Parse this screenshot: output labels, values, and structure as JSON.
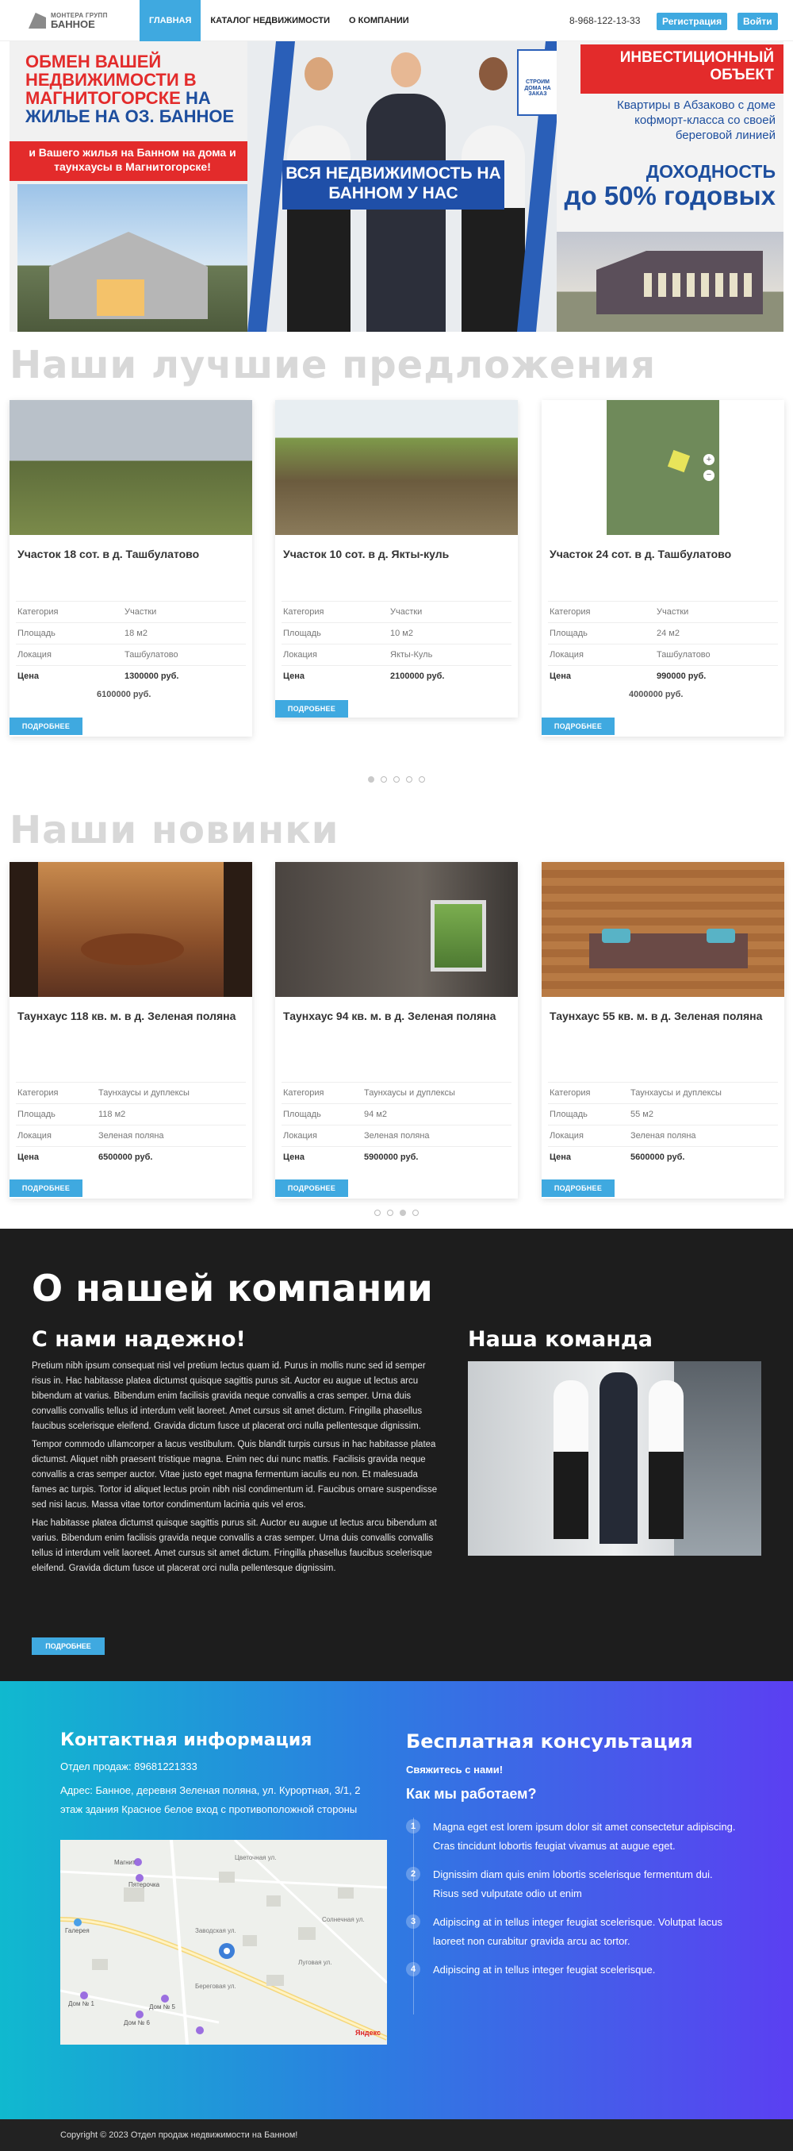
{
  "header": {
    "logo_line1": "МОНТЕРА ГРУПП",
    "logo_line2": "БАННОЕ",
    "nav": [
      "ГЛАВНАЯ",
      "КАТАЛОГ НЕДВИЖИМОСТИ",
      "О КОМПАНИИ"
    ],
    "active_nav": "ГЛАВНАЯ",
    "phone": "8-968-122-13-33",
    "register": "Регистрация",
    "login": "Войти"
  },
  "banner": {
    "left_title_red": "ОБМЕН ВАШЕЙ НЕДВИЖИМОСТИ В МАГНИТОГОРСКЕ",
    "left_title_blue": "НА ЖИЛЬЕ НА ОЗ. БАННОЕ",
    "left_red_box": "и Вашего жилья на Банном на дома и таунхаусы в Магнитогорске!",
    "center_box": "ВСЯ НЕДВИЖИМОСТЬ НА БАННОМ У НАС",
    "sign": "СТРОИМ ДОМА НА ЗАКАЗ",
    "right_red_box": "ИНВЕСТИЦИОННЫЙ ОБЪЕКТ",
    "right_sub": "Квартиры в Абзаково с доме кофморт-класса со своей береговой линией",
    "yield_line1": "ДОХОДНОСТЬ",
    "yield_line2": "до 50% годовых"
  },
  "best": {
    "title": "Наши лучшие предложения",
    "labels": {
      "category": "Категория",
      "area": "Площадь",
      "location": "Локация",
      "price": "Цена"
    },
    "more": "ПОДРОБНЕЕ",
    "cards": [
      {
        "title": "Участок 18 сот. в д. Ташбулатово",
        "category": "Участки",
        "area": "18 м2",
        "location": "Ташбулатово",
        "price": "1300000 руб.",
        "ghost_price": "6100000 руб."
      },
      {
        "title": "Участок 10 сот. в д. Якты-куль",
        "category": "Участки",
        "area": "10 м2",
        "location": "Якты-Куль",
        "price": "2100000 руб.",
        "ghost_price": ""
      },
      {
        "title": "Участок 24 сот. в д. Ташбулатово",
        "category": "Участки",
        "area": "24 м2",
        "location": "Ташбулатово",
        "price": "990000 руб.",
        "ghost_price": "4000000 руб."
      }
    ],
    "dots": 5,
    "active_dot": 0
  },
  "news": {
    "title": "Наши новинки",
    "cards": [
      {
        "title": "Таунхаус 118 кв. м. в д. Зеленая поляна",
        "category": "Таунхаусы и дуплексы",
        "area": "118 м2",
        "location": "Зеленая поляна",
        "price": "6500000 руб."
      },
      {
        "title": "Таунхаус 94 кв. м. в д. Зеленая поляна",
        "category": "Таунхаусы и дуплексы",
        "area": "94 м2",
        "location": "Зеленая поляна",
        "price": "5900000 руб."
      },
      {
        "title": "Таунхаус 55 кв. м. в д. Зеленая поляна",
        "category": "Таунхаусы и дуплексы",
        "area": "55 м2",
        "location": "Зеленая поляна",
        "price": "5600000 руб."
      }
    ],
    "dots": 4,
    "active_dot": 2
  },
  "about": {
    "title": "О нашей компании",
    "reliable": "С нами надежно!",
    "team": "Наша команда",
    "paragraphs": [
      "Pretium nibh ipsum consequat nisl vel pretium lectus quam id. Purus in mollis nunc sed id semper risus in. Hac habitasse platea dictumst quisque sagittis purus sit. Auctor eu augue ut lectus arcu bibendum at varius. Bibendum enim facilisis gravida neque convallis a cras semper. Urna duis convallis convallis tellus id interdum velit laoreet. Amet cursus sit amet dictum. Fringilla phasellus faucibus scelerisque eleifend. Gravida dictum fusce ut placerat orci nulla pellentesque dignissim.",
      "Tempor commodo ullamcorper a lacus vestibulum. Quis blandit turpis cursus in hac habitasse platea dictumst. Aliquet nibh praesent tristique magna. Enim nec dui nunc mattis. Facilisis gravida neque convallis a cras semper auctor. Vitae justo eget magna fermentum iaculis eu non. Et malesuada fames ac turpis. Tortor id aliquet lectus proin nibh nisl condimentum id. Faucibus ornare suspendisse sed nisi lacus. Massa vitae tortor condimentum lacinia quis vel eros.",
      "Hac habitasse platea dictumst quisque sagittis purus sit. Auctor eu augue ut lectus arcu bibendum at varius. Bibendum enim facilisis gravida neque convallis a cras semper. Urna duis convallis convallis tellus id interdum velit laoreet. Amet cursus sit amet dictum. Fringilla phasellus faucibus scelerisque eleifend. Gravida dictum fusce ut placerat orci nulla pellentesque dignissim."
    ],
    "more": "ПОДРОБНЕЕ"
  },
  "contact": {
    "title": "Контактная информация",
    "phone_line": "Отдел продаж: 89681221333",
    "address_line": "Адрес: Банное, деревня Зеленая поляна, ул. Курортная, 3/1, 2 этаж здания Красное белое вход с противоположной стороны",
    "consult_title": "Бесплатная консультация",
    "contact_us": "Свяжитесь с нами!",
    "how_title": "Как мы работаем?",
    "steps": [
      "Magna eget est lorem ipsum dolor sit amet consectetur adipiscing. Cras tincidunt lobortis feugiat vivamus at augue eget.",
      "Dignissim diam quis enim lobortis scelerisque fermentum dui. Risus sed vulputate odio ut enim",
      "Adipiscing at in tellus integer feugiat scelerisque. Volutpat lacus laoreet non curabitur gravida arcu ac tortor.",
      "Adipiscing at in tellus integer feugiat scelerisque."
    ],
    "map_labels": [
      "Магнит",
      "Пятерочка",
      "Галерея",
      "Цветочная ул.",
      "Солнечная ул.",
      "Луговая ул.",
      "Заводская ул.",
      "Береговая ул.",
      "Дом № 1",
      "Дом № 6",
      "Дом № 5",
      "Яндекс"
    ]
  },
  "footer": {
    "copyright": "Copyright © 2023 Отдел продаж недвижимости на Банном!"
  },
  "colors": {
    "accent": "#3fa9e0",
    "banner_red": "#e32b2b",
    "banner_blue": "#1d4e9e",
    "dark": "#1d1d1d"
  }
}
